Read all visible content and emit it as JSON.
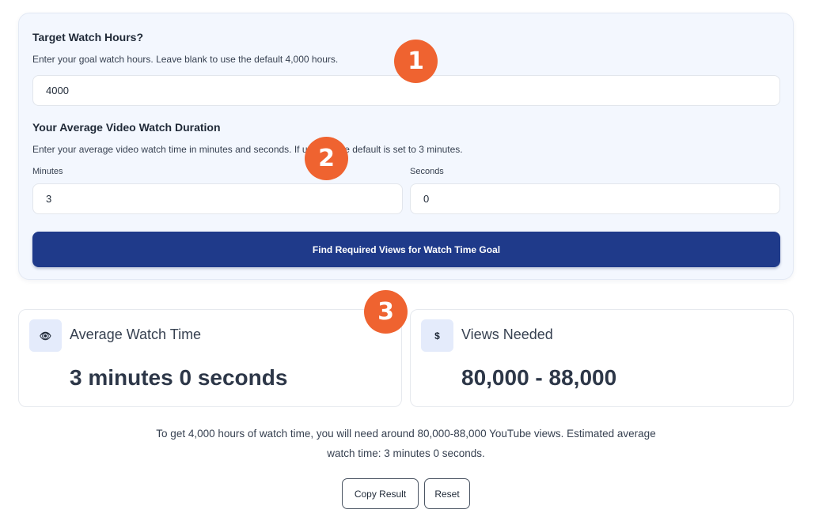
{
  "target": {
    "title": "Target Watch Hours?",
    "help": "Enter your goal watch hours. Leave blank to use the default 4,000 hours.",
    "value": "4000"
  },
  "duration": {
    "title": "Your Average Video Watch Duration",
    "help": "Enter your average video watch time in minutes and seconds. If unsure, the default is set to 3 minutes.",
    "minutes_label": "Minutes",
    "minutes_value": "3",
    "seconds_label": "Seconds",
    "seconds_value": "0"
  },
  "submit_label": "Find Required Views for Watch Time Goal",
  "markers": [
    "1",
    "2",
    "3"
  ],
  "results": {
    "watch_time": {
      "icon": "eye-icon",
      "icon_glyph": "👁",
      "title": "Average Watch Time",
      "value": "3 minutes 0 seconds"
    },
    "views": {
      "icon": "dollar-icon",
      "icon_glyph": "$",
      "title": "Views Needed",
      "value": "80,000 - 88,000"
    }
  },
  "summary_line1": "To get 4,000 hours of watch time, you will need around 80,000-88,000 YouTube views. Estimated average",
  "summary_line2": "watch time: 3 minutes 0 seconds.",
  "buttons": {
    "copy": "Copy Result",
    "reset": "Reset"
  },
  "colors": {
    "primary": "#1f3a8a",
    "marker": "#ef6330",
    "card_bg": "#f3f7fe",
    "icon_bg": "#e4ebfb"
  }
}
